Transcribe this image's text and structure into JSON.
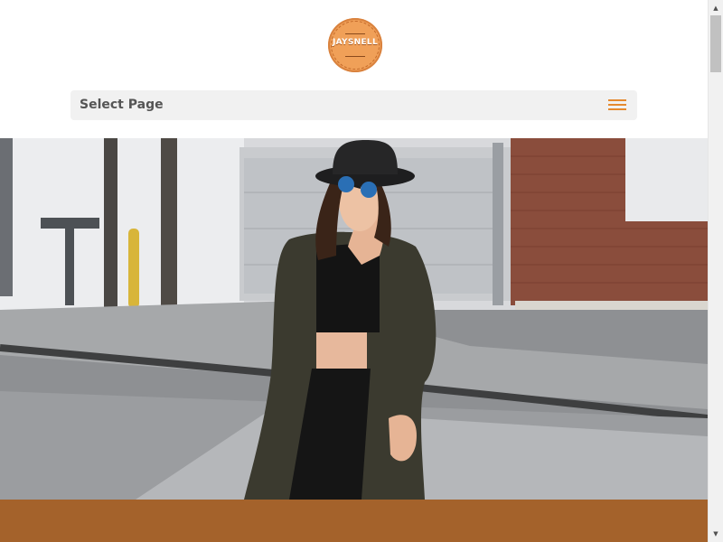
{
  "header": {
    "logo_text": "JAYSNELL",
    "menu_label": "Select Page",
    "menu_icon": "hamburger-icon"
  },
  "hero": {
    "image_description": "hero-photo"
  },
  "colors": {
    "accent": "#e58a2f",
    "logo_fill": "#f0a058",
    "band": "#a4622b",
    "menu_bg": "#f1f1f1",
    "menu_text": "#555555"
  },
  "scrollbar": {
    "up_icon": "chevron-up-icon",
    "down_icon": "chevron-down-icon"
  }
}
